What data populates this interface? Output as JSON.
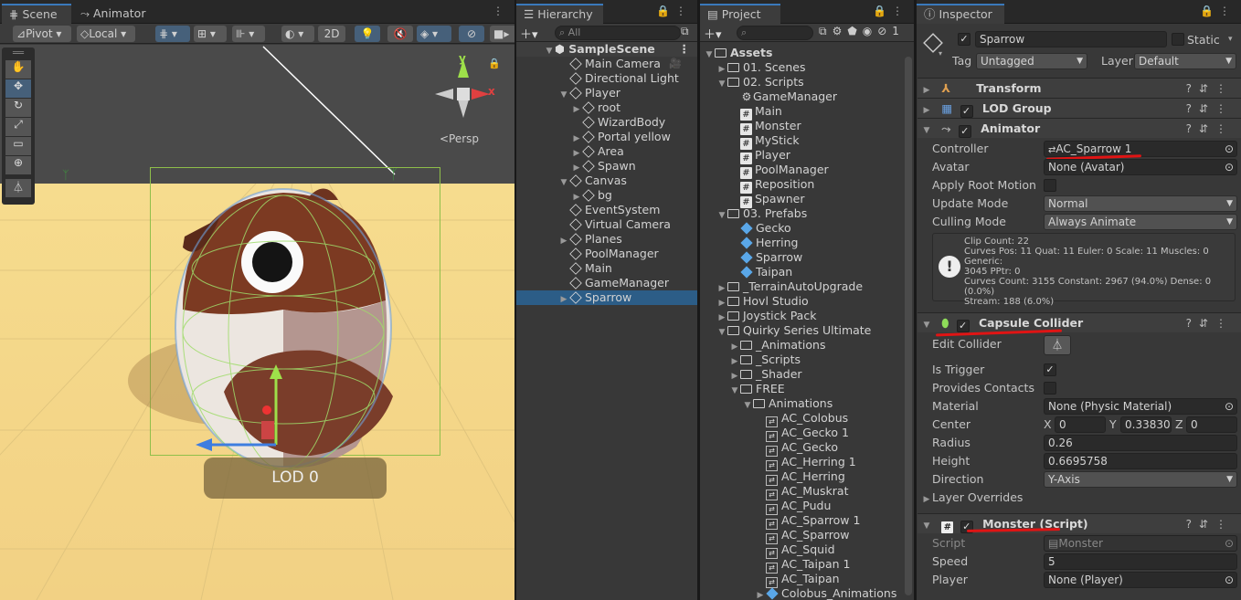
{
  "scene": {
    "tab_scene": "Scene",
    "tab_animator": "Animator",
    "pivot": "Pivot",
    "local": "Local",
    "mode2d": "2D",
    "persp": "<Persp",
    "lod_label": "LOD 0",
    "gizmo_x": "x",
    "gizmo_y": "y",
    "sky": "#4a4a4a",
    "ground": "#f6dc8e"
  },
  "hierarchy": {
    "tab": "Hierarchy",
    "search": "All",
    "scene_name": "SampleScene",
    "items": [
      {
        "label": "Main Camera",
        "depth": 1,
        "arrow": ""
      },
      {
        "label": "Directional Light",
        "depth": 1,
        "arrow": ""
      },
      {
        "label": "Player",
        "depth": 1,
        "arrow": "▼"
      },
      {
        "label": "root",
        "depth": 2,
        "arrow": "▶"
      },
      {
        "label": "WizardBody",
        "depth": 2,
        "arrow": ""
      },
      {
        "label": "Portal yellow",
        "depth": 2,
        "arrow": "▶"
      },
      {
        "label": "Area",
        "depth": 2,
        "arrow": "▶"
      },
      {
        "label": "Spawn",
        "depth": 2,
        "arrow": "▶"
      },
      {
        "label": "Canvas",
        "depth": 1,
        "arrow": "▼"
      },
      {
        "label": "bg",
        "depth": 2,
        "arrow": "▶"
      },
      {
        "label": "EventSystem",
        "depth": 1,
        "arrow": ""
      },
      {
        "label": "Virtual Camera",
        "depth": 1,
        "arrow": ""
      },
      {
        "label": "Planes",
        "depth": 1,
        "arrow": "▶"
      },
      {
        "label": "PoolManager",
        "depth": 1,
        "arrow": ""
      },
      {
        "label": "Main",
        "depth": 1,
        "arrow": ""
      },
      {
        "label": "GameManager",
        "depth": 1,
        "arrow": ""
      },
      {
        "label": "Sparrow",
        "depth": 1,
        "arrow": "▶",
        "selected": true
      }
    ]
  },
  "project": {
    "tab": "Project",
    "badge": "1",
    "items": [
      {
        "label": "Assets",
        "depth": 0,
        "arrow": "▼",
        "type": "folder",
        "bold": true
      },
      {
        "label": "01. Scenes",
        "depth": 1,
        "arrow": "▶",
        "type": "folder"
      },
      {
        "label": "02. Scripts",
        "depth": 1,
        "arrow": "▼",
        "type": "folder"
      },
      {
        "label": "GameManager",
        "depth": 2,
        "arrow": "",
        "type": "gear"
      },
      {
        "label": "Main",
        "depth": 2,
        "arrow": "",
        "type": "script"
      },
      {
        "label": "Monster",
        "depth": 2,
        "arrow": "",
        "type": "script"
      },
      {
        "label": "MyStick",
        "depth": 2,
        "arrow": "",
        "type": "script"
      },
      {
        "label": "Player",
        "depth": 2,
        "arrow": "",
        "type": "script"
      },
      {
        "label": "PoolManager",
        "depth": 2,
        "arrow": "",
        "type": "script"
      },
      {
        "label": "Reposition",
        "depth": 2,
        "arrow": "",
        "type": "script"
      },
      {
        "label": "Spawner",
        "depth": 2,
        "arrow": "",
        "type": "script"
      },
      {
        "label": "03. Prefabs",
        "depth": 1,
        "arrow": "▼",
        "type": "folder"
      },
      {
        "label": "Gecko",
        "depth": 2,
        "arrow": "",
        "type": "prefab"
      },
      {
        "label": "Herring",
        "depth": 2,
        "arrow": "",
        "type": "prefab"
      },
      {
        "label": "Sparrow",
        "depth": 2,
        "arrow": "",
        "type": "prefab"
      },
      {
        "label": "Taipan",
        "depth": 2,
        "arrow": "",
        "type": "prefab"
      },
      {
        "label": "_TerrainAutoUpgrade",
        "depth": 1,
        "arrow": "▶",
        "type": "folder"
      },
      {
        "label": "Hovl Studio",
        "depth": 1,
        "arrow": "▶",
        "type": "folder"
      },
      {
        "label": "Joystick Pack",
        "depth": 1,
        "arrow": "▶",
        "type": "folder"
      },
      {
        "label": "Quirky Series Ultimate",
        "depth": 1,
        "arrow": "▼",
        "type": "folder"
      },
      {
        "label": "_Animations",
        "depth": 2,
        "arrow": "▶",
        "type": "folder"
      },
      {
        "label": "_Scripts",
        "depth": 2,
        "arrow": "▶",
        "type": "folder"
      },
      {
        "label": "_Shader",
        "depth": 2,
        "arrow": "▶",
        "type": "folder"
      },
      {
        "label": "FREE",
        "depth": 2,
        "arrow": "▼",
        "type": "folder"
      },
      {
        "label": "Animations",
        "depth": 3,
        "arrow": "▼",
        "type": "folder"
      },
      {
        "label": "AC_Colobus",
        "depth": 4,
        "arrow": "",
        "type": "anim"
      },
      {
        "label": "AC_Gecko 1",
        "depth": 4,
        "arrow": "",
        "type": "anim"
      },
      {
        "label": "AC_Gecko",
        "depth": 4,
        "arrow": "",
        "type": "anim"
      },
      {
        "label": "AC_Herring 1",
        "depth": 4,
        "arrow": "",
        "type": "anim"
      },
      {
        "label": "AC_Herring",
        "depth": 4,
        "arrow": "",
        "type": "anim"
      },
      {
        "label": "AC_Muskrat",
        "depth": 4,
        "arrow": "",
        "type": "anim"
      },
      {
        "label": "AC_Pudu",
        "depth": 4,
        "arrow": "",
        "type": "anim"
      },
      {
        "label": "AC_Sparrow 1",
        "depth": 4,
        "arrow": "",
        "type": "anim"
      },
      {
        "label": "AC_Sparrow",
        "depth": 4,
        "arrow": "",
        "type": "anim"
      },
      {
        "label": "AC_Squid",
        "depth": 4,
        "arrow": "",
        "type": "anim"
      },
      {
        "label": "AC_Taipan 1",
        "depth": 4,
        "arrow": "",
        "type": "anim"
      },
      {
        "label": "AC_Taipan",
        "depth": 4,
        "arrow": "",
        "type": "anim"
      },
      {
        "label": "Colobus_Animations",
        "depth": 4,
        "arrow": "▶",
        "type": "prefab"
      }
    ]
  },
  "inspector": {
    "tab": "Inspector",
    "object_name": "Sparrow",
    "static_label": "Static",
    "tag_label": "Tag",
    "tag_value": "Untagged",
    "layer_label": "Layer",
    "layer_value": "Default",
    "transform": "Transform",
    "lod_group": "LOD Group",
    "animator": "Animator",
    "controller_label": "Controller",
    "controller_value": "AC_Sparrow 1",
    "avatar_label": "Avatar",
    "avatar_value": "None (Avatar)",
    "apply_root_label": "Apply Root Motion",
    "update_mode_label": "Update Mode",
    "update_mode_value": "Normal",
    "culling_mode_label": "Culling Mode",
    "culling_mode_value": "Always Animate",
    "info_1": "Clip Count: 22",
    "info_2": "Curves Pos: 11 Quat: 11 Euler: 0 Scale: 11 Muscles: 0 Generic:",
    "info_3": "3045 PPtr: 0",
    "info_4": "Curves Count: 3155 Constant: 2967 (94.0%) Dense: 0 (0.0%)",
    "info_5": "Stream: 188 (6.0%)",
    "capsule_collider": "Capsule Collider",
    "edit_collider_label": "Edit Collider",
    "is_trigger_label": "Is Trigger",
    "provides_contacts_label": "Provides Contacts",
    "material_label": "Material",
    "material_value": "None (Physic Material)",
    "center_label": "Center",
    "center_x_label": "X",
    "center_x": "0",
    "center_y_label": "Y",
    "center_y": "0.33830",
    "center_z_label": "Z",
    "center_z": "0",
    "radius_label": "Radius",
    "radius_value": "0.26",
    "height_label": "Height",
    "height_value": "0.6695758",
    "direction_label": "Direction",
    "direction_value": "Y-Axis",
    "layer_overrides": "Layer Overrides",
    "monster_script": "Monster (Script)",
    "script_label": "Script",
    "script_value": "Monster",
    "speed_label": "Speed",
    "speed_value": "5",
    "player_label": "Player",
    "player_value": "None (Player)"
  }
}
